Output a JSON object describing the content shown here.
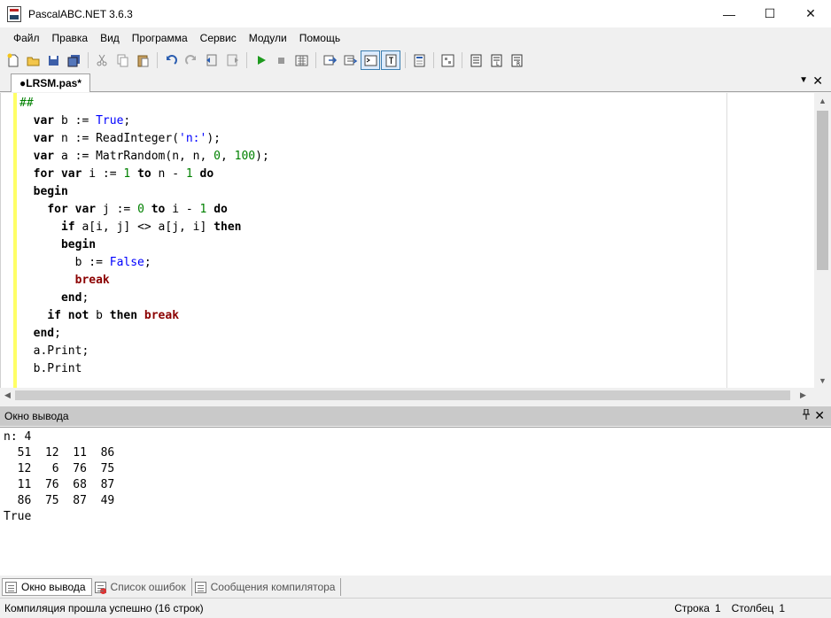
{
  "window": {
    "title": "PascalABC.NET 3.6.3",
    "minimize": "—",
    "maximize": "☐",
    "close": "✕"
  },
  "menu": [
    "Файл",
    "Правка",
    "Вид",
    "Программа",
    "Сервис",
    "Модули",
    "Помощь"
  ],
  "toolbar": {
    "icons": [
      "new-file-icon",
      "open-folder-icon",
      "save-icon",
      "save-all-icon",
      "sep",
      "cut-icon",
      "copy-icon",
      "paste-icon",
      "sep",
      "undo-icon",
      "redo-icon",
      "indent-left-icon",
      "indent-right-icon",
      "sep",
      "run-icon",
      "stop-icon",
      "compile-icon",
      "sep",
      "step-into-icon",
      "step-over-icon",
      "console-icon",
      "text-mode-icon",
      "sep",
      "form-designer-icon",
      "sep",
      "code-template-icon",
      "sep",
      "debug-window-icon",
      "local-vars-icon",
      "watch-icon"
    ],
    "active": [
      "console-icon",
      "text-mode-icon"
    ]
  },
  "tab": {
    "label": "●LRSM.pas*",
    "dropdown": "▼",
    "close": "✕"
  },
  "code_lines": [
    [
      [
        "hash",
        "##"
      ]
    ],
    [
      [
        "t",
        "  "
      ],
      [
        "kw",
        "var"
      ],
      [
        "t",
        " b := "
      ],
      [
        "const",
        "True"
      ],
      [
        "t",
        ";"
      ]
    ],
    [
      [
        "t",
        "  "
      ],
      [
        "kw",
        "var"
      ],
      [
        "t",
        " n := ReadInteger("
      ],
      [
        "str",
        "'n:'"
      ],
      [
        "t",
        ");"
      ]
    ],
    [
      [
        "t",
        "  "
      ],
      [
        "kw",
        "var"
      ],
      [
        "t",
        " a := MatrRandom(n, n, "
      ],
      [
        "num",
        "0"
      ],
      [
        "t",
        ", "
      ],
      [
        "num",
        "100"
      ],
      [
        "t",
        ");"
      ]
    ],
    [
      [
        "t",
        "  "
      ],
      [
        "kw",
        "for var"
      ],
      [
        "t",
        " i := "
      ],
      [
        "num",
        "1"
      ],
      [
        "t",
        " "
      ],
      [
        "kw",
        "to"
      ],
      [
        "t",
        " n - "
      ],
      [
        "num",
        "1"
      ],
      [
        "t",
        " "
      ],
      [
        "kw",
        "do"
      ]
    ],
    [
      [
        "t",
        "  "
      ],
      [
        "kw",
        "begin"
      ]
    ],
    [
      [
        "t",
        "    "
      ],
      [
        "kw",
        "for var"
      ],
      [
        "t",
        " j := "
      ],
      [
        "num",
        "0"
      ],
      [
        "t",
        " "
      ],
      [
        "kw",
        "to"
      ],
      [
        "t",
        " i - "
      ],
      [
        "num",
        "1"
      ],
      [
        "t",
        " "
      ],
      [
        "kw",
        "do"
      ]
    ],
    [
      [
        "t",
        "      "
      ],
      [
        "kw",
        "if"
      ],
      [
        "t",
        " a[i, j] <> a[j, i] "
      ],
      [
        "kw",
        "then"
      ]
    ],
    [
      [
        "t",
        "      "
      ],
      [
        "kw",
        "begin"
      ]
    ],
    [
      [
        "t",
        "        b := "
      ],
      [
        "const",
        "False"
      ],
      [
        "t",
        ";"
      ]
    ],
    [
      [
        "t",
        "        "
      ],
      [
        "brk",
        "break"
      ]
    ],
    [
      [
        "t",
        "      "
      ],
      [
        "kw",
        "end"
      ],
      [
        "t",
        ";"
      ]
    ],
    [
      [
        "t",
        "    "
      ],
      [
        "kw",
        "if not"
      ],
      [
        "t",
        " b "
      ],
      [
        "kw",
        "then"
      ],
      [
        "t",
        " "
      ],
      [
        "brk",
        "break"
      ]
    ],
    [
      [
        "t",
        "  "
      ],
      [
        "kw",
        "end"
      ],
      [
        "t",
        ";"
      ]
    ],
    [
      [
        "t",
        "  a.Print;"
      ]
    ],
    [
      [
        "t",
        "  b.Print"
      ]
    ]
  ],
  "output_panel": {
    "title": "Окно вывода",
    "pin": "📌",
    "close": "✕",
    "lines": [
      "n: 4",
      "  51  12  11  86",
      "  12   6  76  75",
      "  11  76  68  87",
      "  86  75  87  49",
      "True"
    ]
  },
  "bottom_tabs": [
    {
      "label": "Окно вывода",
      "icon": "output-window-icon",
      "active": true
    },
    {
      "label": "Список ошибок",
      "icon": "error-list-icon",
      "active": false
    },
    {
      "label": "Сообщения компилятора",
      "icon": "compiler-messages-icon",
      "active": false
    }
  ],
  "status": {
    "message": "Компиляция прошла успешно (16 строк)",
    "line_label": "Строка",
    "line": "1",
    "col_label": "Столбец",
    "col": "1"
  }
}
